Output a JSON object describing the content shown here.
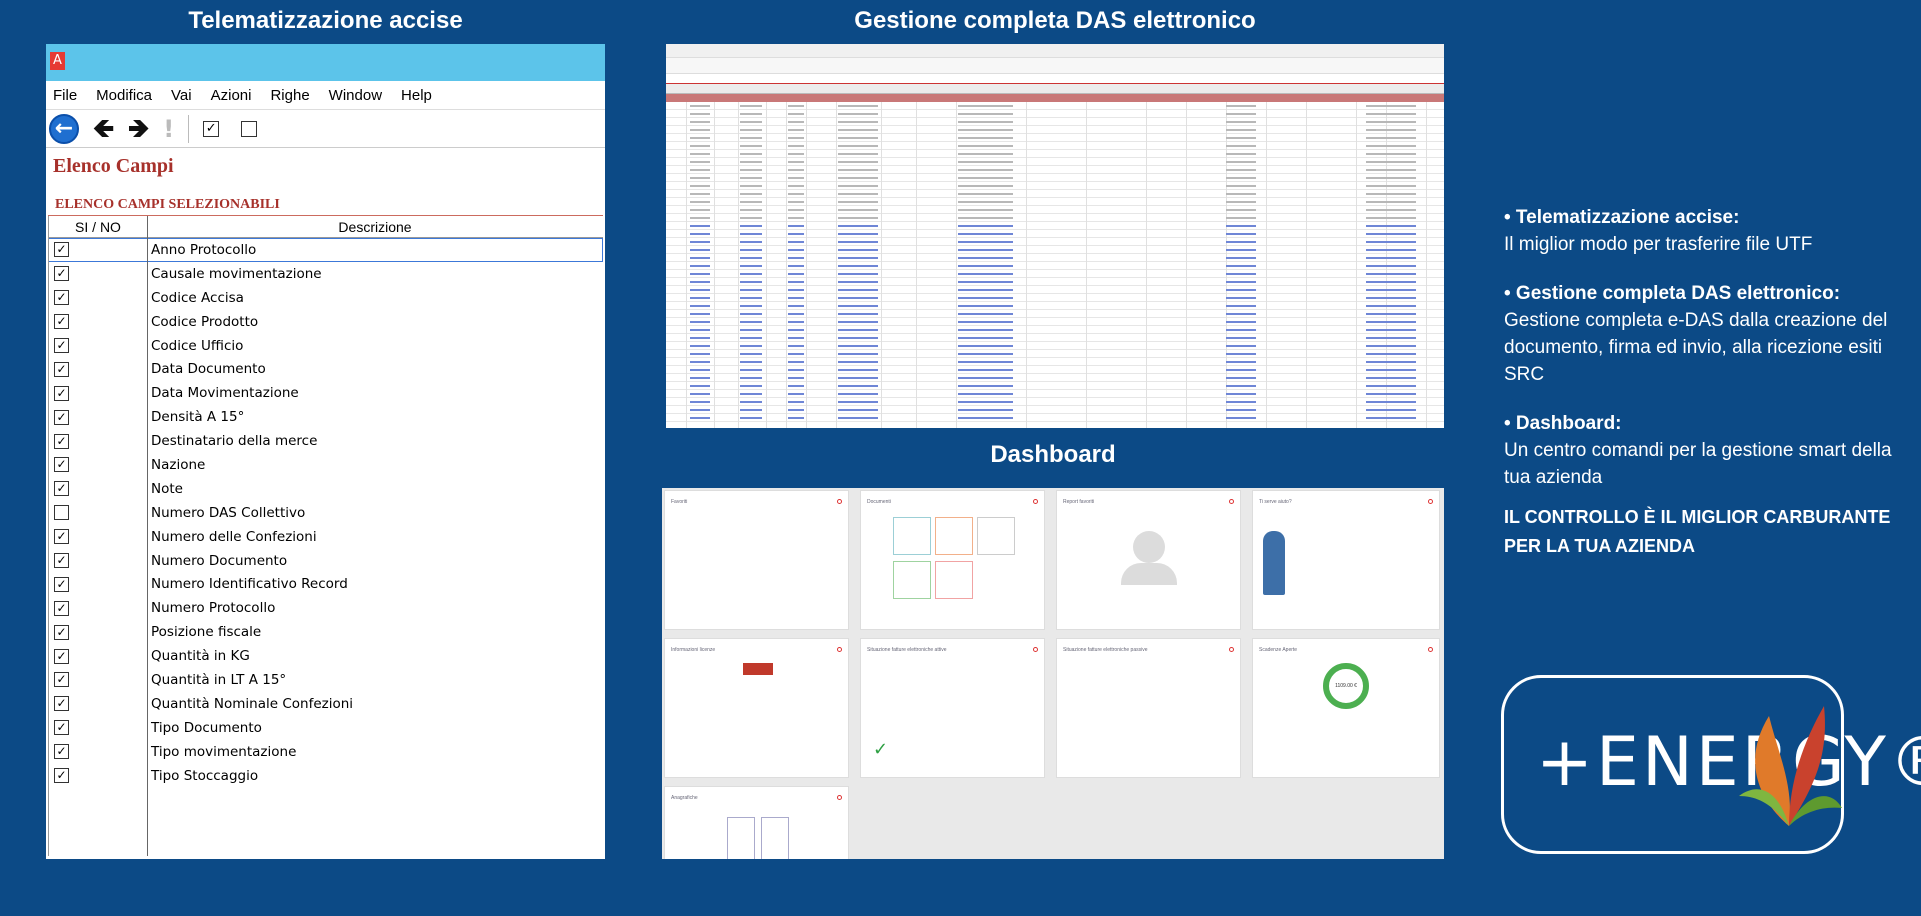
{
  "headings": {
    "left": "Telematizzazione accise",
    "middle": "Gestione completa DAS elettronico",
    "dashboard": "Dashboard"
  },
  "app_window": {
    "app_icon_letter": "A",
    "menu": [
      "File",
      "Modifica",
      "Vai",
      "Azioni",
      "Righe",
      "Window",
      "Help"
    ],
    "toolbar_icons": [
      "back-icon",
      "arrow-left-icon",
      "arrow-right-icon",
      "exclamation-icon",
      "checkbox-checked-icon",
      "checkbox-empty-icon"
    ],
    "title": "Elenco Campi",
    "subtitle": "ELENCO CAMPI SELEZIONABILI",
    "columns": [
      "SI / NO",
      "Descrizione"
    ],
    "rows": [
      {
        "label": "Anno Protocollo",
        "checked": true
      },
      {
        "label": "Causale movimentazione",
        "checked": true
      },
      {
        "label": "Codice Accisa",
        "checked": true
      },
      {
        "label": "Codice Prodotto",
        "checked": true
      },
      {
        "label": "Codice Ufficio",
        "checked": true
      },
      {
        "label": "Data Documento",
        "checked": true
      },
      {
        "label": "Data Movimentazione",
        "checked": true
      },
      {
        "label": "Densità A 15°",
        "checked": true
      },
      {
        "label": "Destinatario della merce",
        "checked": true
      },
      {
        "label": "Nazione",
        "checked": true
      },
      {
        "label": "Note",
        "checked": true
      },
      {
        "label": "Numero DAS Collettivo",
        "checked": false
      },
      {
        "label": "Numero delle Confezioni",
        "checked": true
      },
      {
        "label": "Numero Documento",
        "checked": true
      },
      {
        "label": "Numero Identificativo Record",
        "checked": true
      },
      {
        "label": "Numero Protocollo",
        "checked": true
      },
      {
        "label": "Posizione fiscale",
        "checked": true
      },
      {
        "label": "Quantità in KG",
        "checked": true
      },
      {
        "label": "Quantità in LT A 15°",
        "checked": true
      },
      {
        "label": "Quantità Nominale Confezioni",
        "checked": true
      },
      {
        "label": "Tipo Documento",
        "checked": true
      },
      {
        "label": "Tipo movimentazione",
        "checked": true
      },
      {
        "label": "Tipo Stoccaggio",
        "checked": true
      }
    ]
  },
  "dashboard": {
    "cards": [
      "Favoriti",
      "Documenti",
      "Report favoriti",
      "Ti serve aiuto?",
      "Informazioni licenze",
      "Situazione fatture elettroniche attive",
      "Situazione fatture elettroniche passive",
      "Scadenze Aperte",
      "Anagrafiche"
    ],
    "donut_value": "1109.00 €"
  },
  "features": [
    {
      "title": "• Telematizzazione accise:",
      "text": "Il miglior modo per trasferire file UTF"
    },
    {
      "title": "• Gestione completa DAS elettronico:",
      "text": "Gestione completa e-DAS dalla creazione del documento, firma ed invio, alla ricezione esiti SRC"
    },
    {
      "title": "• Dashboard:",
      "text": "Un centro comandi per la gestione smart della tua azienda"
    }
  ],
  "tagline": "IL CONTROLLO È IL MIGLIOR CARBURANTE PER LA TUA AZIENDA",
  "logo": {
    "text": "+ENERGY®"
  },
  "colors": {
    "background": "#0c4a86",
    "titlebar": "#5cc4ea",
    "accent_red": "#a7312b"
  }
}
